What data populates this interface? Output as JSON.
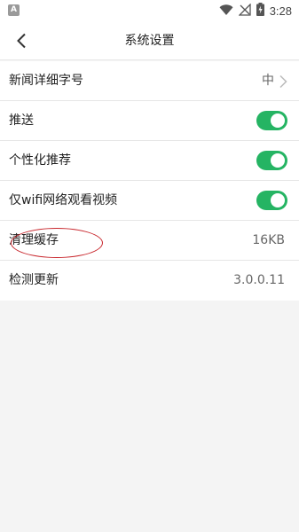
{
  "status_bar": {
    "app_icon_letter": "A",
    "time": "3:28",
    "icons": [
      "wifi-icon",
      "signal-off-icon",
      "battery-charging-icon"
    ]
  },
  "header": {
    "back_icon": "chevron-left-icon",
    "title": "系统设置"
  },
  "settings": {
    "font_size": {
      "label": "新闻详细字号",
      "value": "中"
    },
    "push": {
      "label": "推送",
      "enabled": true
    },
    "personalized": {
      "label": "个性化推荐",
      "enabled": true
    },
    "wifi_video": {
      "label": "仅wifi网络观看视频",
      "enabled": true
    },
    "clear_cache": {
      "label": "清理缓存",
      "value": "16KB"
    },
    "check_update": {
      "label": "检测更新",
      "value": "3.0.0.11"
    }
  },
  "colors": {
    "toggle_on": "#25b463",
    "annotation": "#c8262c"
  }
}
